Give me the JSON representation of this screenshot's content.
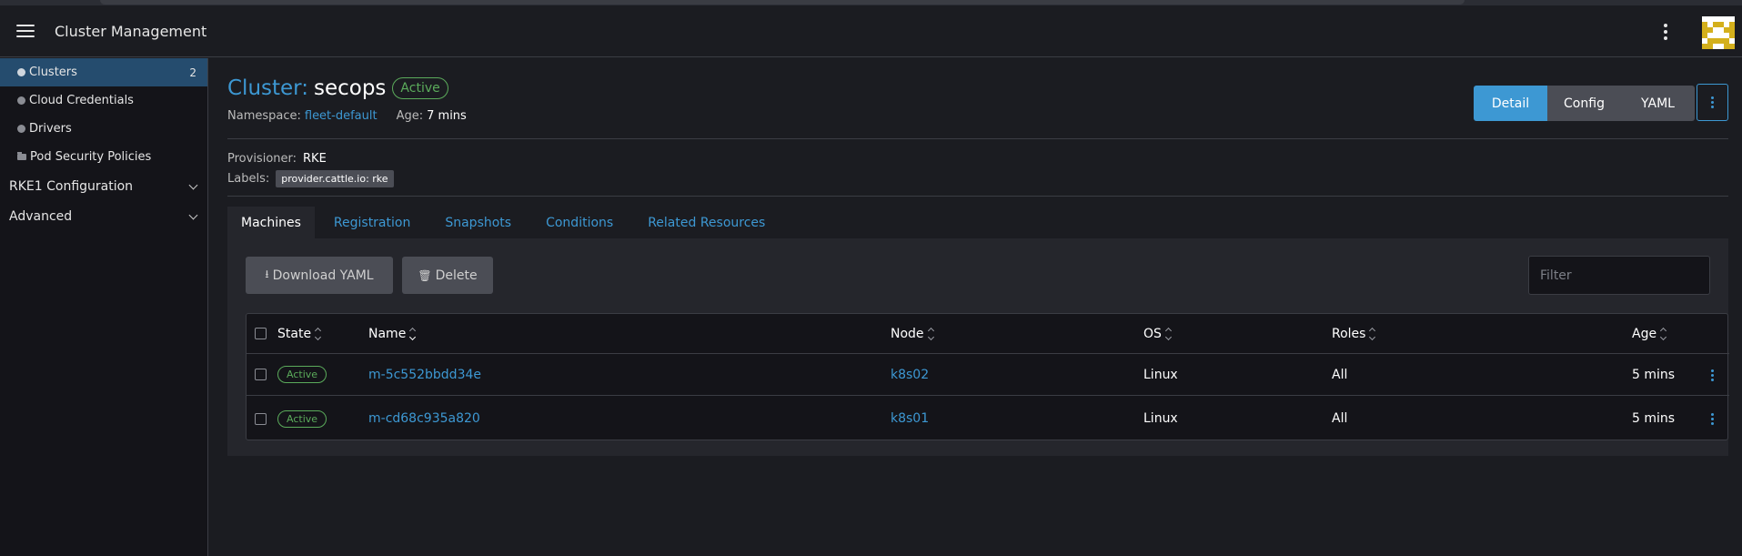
{
  "header": {
    "title": "Cluster Management",
    "menu_icon": "hamburger-menu-icon",
    "more_icon": "kebab-menu-icon",
    "avatar_colors": {
      "background": "#d4b01c",
      "foreground": "#ffffff"
    }
  },
  "sidebar": {
    "items": [
      {
        "label": "Clusters",
        "count": "2",
        "icon": "cluster-icon",
        "active": true
      },
      {
        "label": "Cloud Credentials",
        "icon": "circle-icon"
      },
      {
        "label": "Drivers",
        "icon": "circle-icon"
      },
      {
        "label": "Pod Security Policies",
        "icon": "folder-icon"
      }
    ],
    "groups": [
      {
        "label": "RKE1 Configuration",
        "icon": "chevron-down-icon"
      },
      {
        "label": "Advanced",
        "icon": "chevron-down-icon"
      }
    ]
  },
  "cluster": {
    "title_prefix": "Cluster:",
    "name": "secops",
    "status": "Active",
    "namespace_label": "Namespace:",
    "namespace": "fleet-default",
    "age_label": "Age:",
    "age": "7 mins"
  },
  "view_switch": {
    "buttons": [
      "Detail",
      "Config",
      "YAML"
    ],
    "active": "Detail"
  },
  "details": {
    "provisioner_label": "Provisioner:",
    "provisioner": "RKE",
    "labels_label": "Labels:",
    "label_chip": "provider.cattle.io: rke"
  },
  "tabs": [
    {
      "label": "Machines",
      "active": true
    },
    {
      "label": "Registration"
    },
    {
      "label": "Snapshots"
    },
    {
      "label": "Conditions"
    },
    {
      "label": "Related Resources"
    }
  ],
  "toolbar": {
    "download_label": "Download YAML",
    "download_icon": "download-icon",
    "delete_label": "Delete",
    "delete_icon": "trash-icon",
    "filter_placeholder": "Filter"
  },
  "table": {
    "columns": [
      "State",
      "Name",
      "Node",
      "OS",
      "Roles",
      "Age"
    ],
    "rows": [
      {
        "state": "Active",
        "name": "m-5c552bbdd34e",
        "node": "k8s02",
        "os": "Linux",
        "roles": "All",
        "age": "5 mins"
      },
      {
        "state": "Active",
        "name": "m-cd68c935a820",
        "node": "k8s01",
        "os": "Linux",
        "roles": "All",
        "age": "5 mins"
      }
    ]
  },
  "colors": {
    "accent": "#3d98d3",
    "active_status": "#5bab5b",
    "sidebar_active": "#254c6e",
    "background": "#1b1c21"
  }
}
